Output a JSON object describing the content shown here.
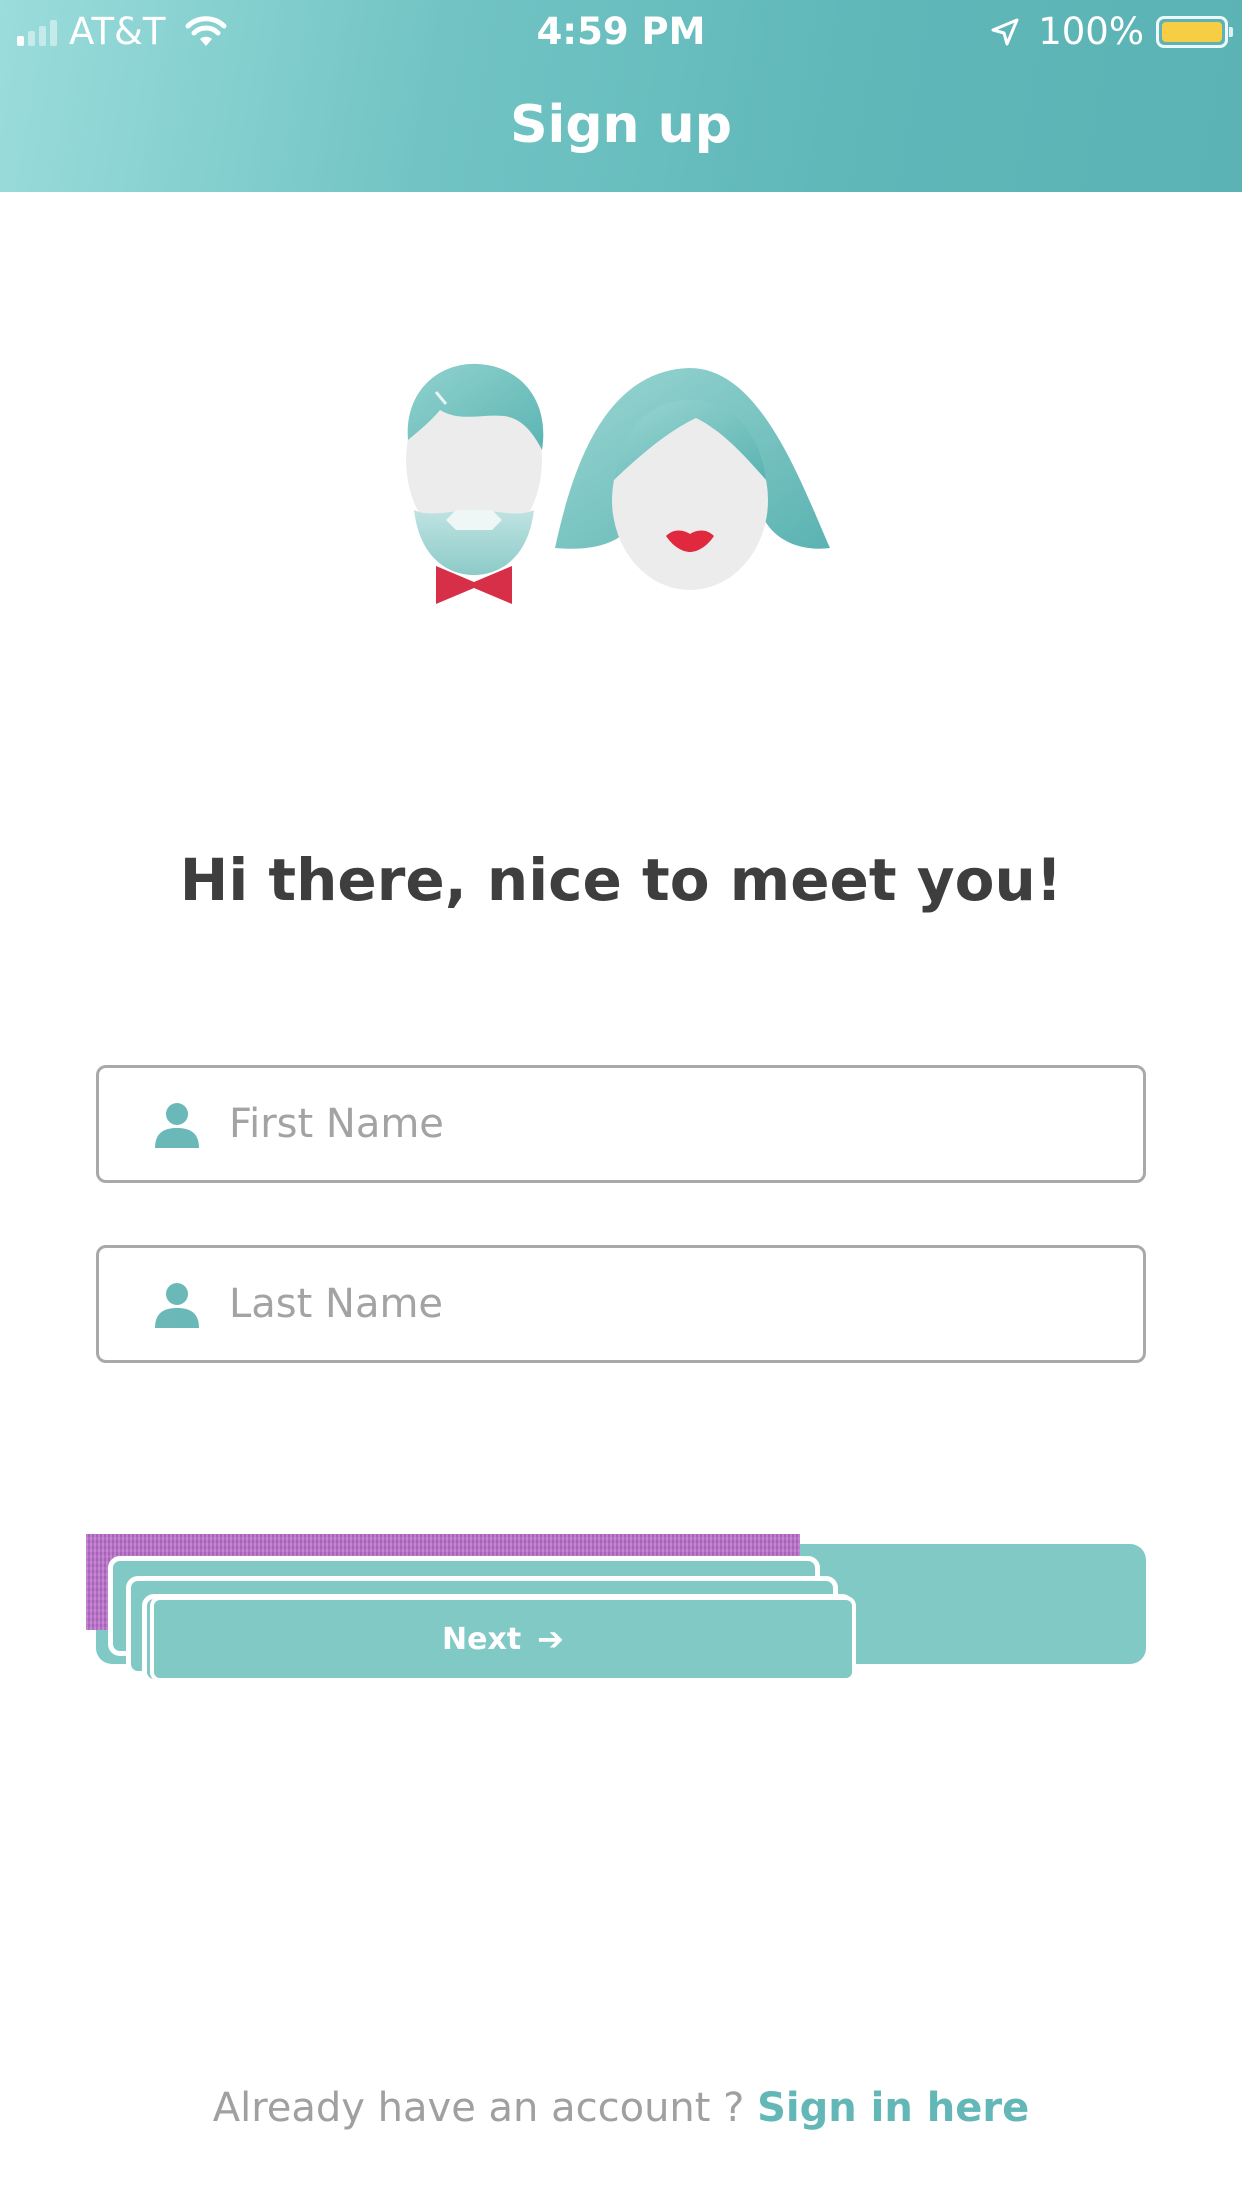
{
  "status_bar": {
    "carrier": "AT&T",
    "time": "4:59 PM",
    "battery_percent": "100%",
    "battery_color": "#f7cd46"
  },
  "header": {
    "title": "Sign up",
    "gradient_from": "#9bdcdc",
    "gradient_to": "#5cb3b5"
  },
  "illustration": {
    "icon": "couple-avatars-illustration"
  },
  "greeting": "Hi there, nice to meet you!",
  "form": {
    "first_name": {
      "placeholder": "First Name",
      "value": "",
      "icon": "person-icon"
    },
    "last_name": {
      "placeholder": "Last Name",
      "value": "",
      "icon": "person-icon"
    }
  },
  "next_button": {
    "label": "Next",
    "icon": "arrow-right-icon",
    "color": "#80c9c5"
  },
  "footer": {
    "prompt": "Already have an account ?",
    "link": "Sign in here",
    "link_color": "#63b7b6"
  }
}
